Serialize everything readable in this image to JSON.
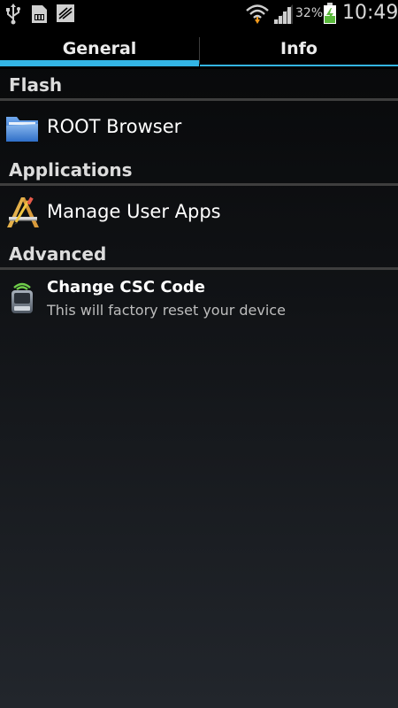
{
  "status_bar": {
    "battery_percent": "32%",
    "time": "10:49",
    "icons": [
      "usb-icon",
      "sd-card-icon",
      "document-icon",
      "wifi-icon",
      "signal-icon",
      "battery-charging-icon"
    ]
  },
  "tabs": [
    {
      "label": "General",
      "selected": true
    },
    {
      "label": "Info",
      "selected": false
    }
  ],
  "accent_color": "#33b5e5",
  "sections": {
    "flash": {
      "title": "Flash",
      "items": [
        {
          "title": "ROOT Browser",
          "icon": "folder-icon"
        }
      ]
    },
    "applications": {
      "title": "Applications",
      "items": [
        {
          "title": "Manage User Apps",
          "icon": "app-tools-icon"
        }
      ]
    },
    "advanced": {
      "title": "Advanced",
      "items": [
        {
          "title": "Change CSC Code",
          "summary": "This will factory reset your device",
          "icon": "android-device-icon"
        }
      ]
    }
  }
}
